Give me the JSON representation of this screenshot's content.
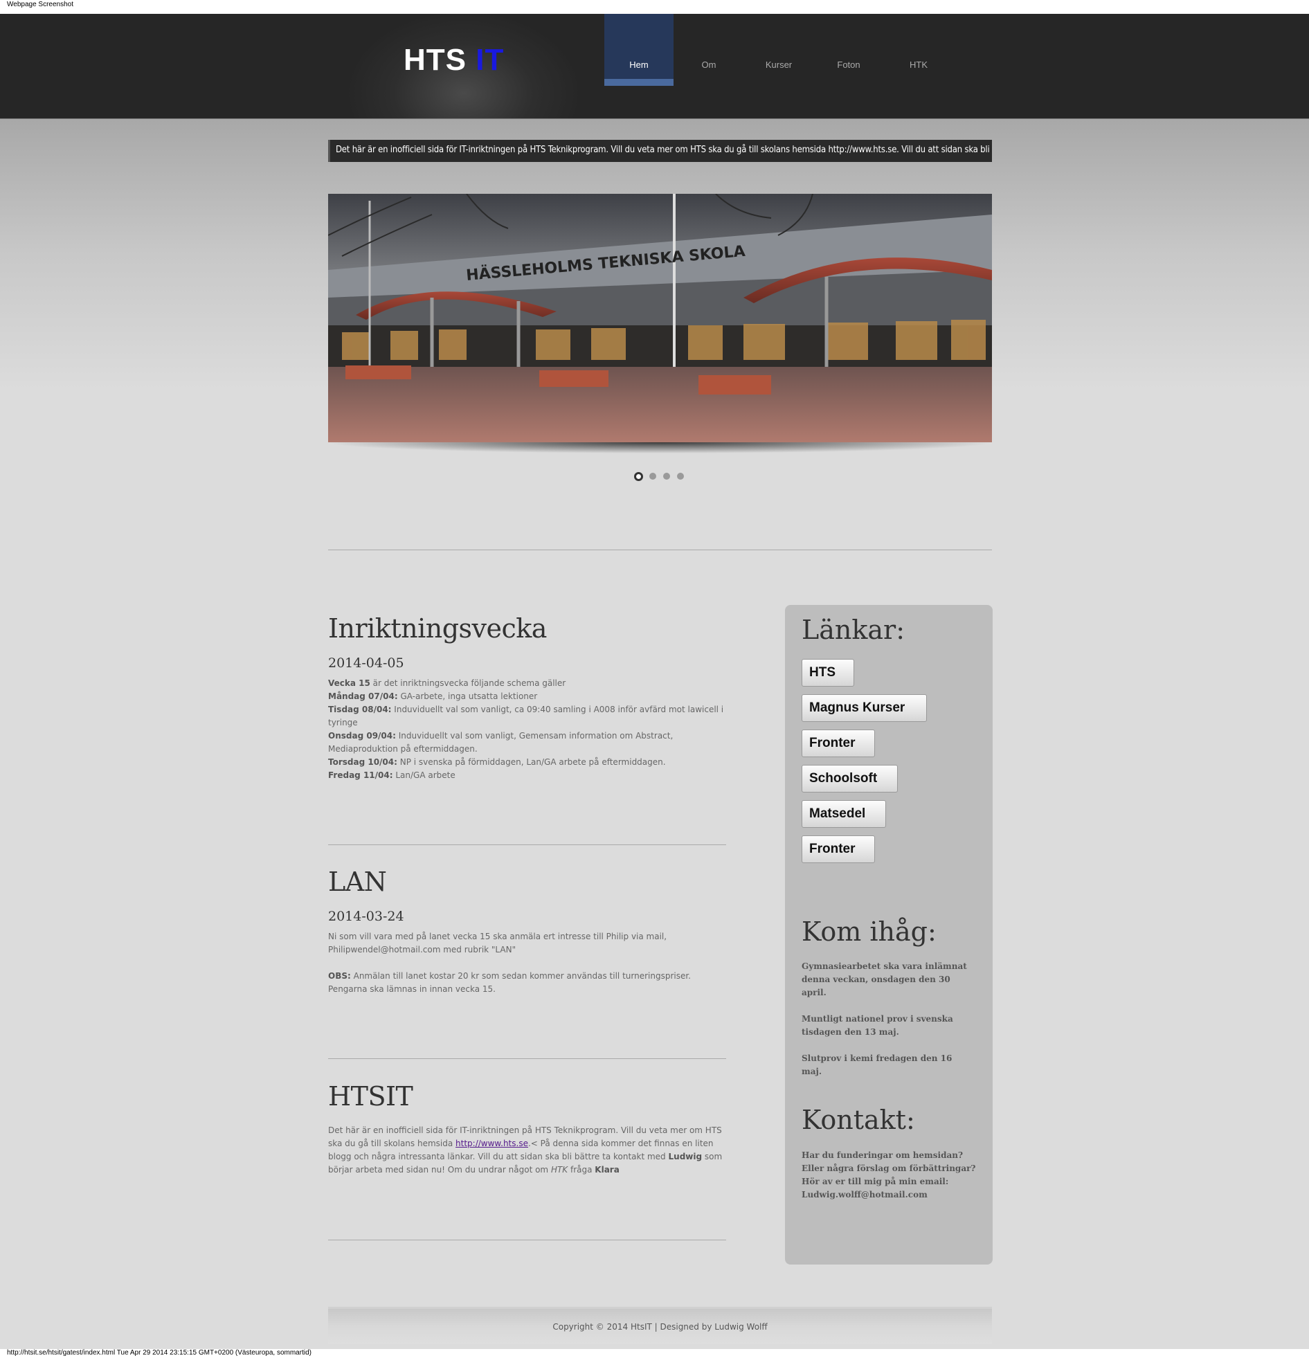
{
  "screenshot_label": "Webpage Screenshot",
  "status_url": "http://htsit.se/htsit/gatest/index.html Tue Apr 29 2014 23:15:15 GMT+0200 (Västeuropa, sommartid)",
  "logo": {
    "text_main": "HTS",
    "text_accent": "IT"
  },
  "nav": [
    {
      "label": "Hem",
      "active": true
    },
    {
      "label": "Om"
    },
    {
      "label": "Kurser"
    },
    {
      "label": "Foton"
    },
    {
      "label": "HTK"
    }
  ],
  "ticker": "Det här är en inofficiell sida för IT-inriktningen på HTS Teknikprogram. Vill du veta mer om HTS ska du gå till skolans hemsida http://www.hts.se. Vill du att sidan ska bli bättre",
  "slider": {
    "sign_text": "HÄSSLEHOLMS TEKNISKA SKOLA",
    "dot_count": 4,
    "active_dot": 0
  },
  "articles": [
    {
      "title": "Inriktningsvecka",
      "date": "2014-04-05",
      "lines": [
        {
          "bold": "Vecka 15",
          "text": " är det inriktningsvecka följande schema gäller"
        },
        {
          "bold": "Måndag 07/04:",
          "text": " GA-arbete, inga utsatta lektioner"
        },
        {
          "bold": "Tisdag 08/04:",
          "text": " Induviduellt val som vanligt, ca 09:40 samling i A008 inför avfärd mot lawicell i tyringe"
        },
        {
          "bold": "Onsdag 09/04:",
          "text": " Induviduellt val som vanligt, Gemensam information om Abstract, Mediaproduktion på eftermiddagen."
        },
        {
          "bold": "Torsdag 10/04:",
          "text": " NP i svenska på förmiddagen, Lan/GA arbete på eftermiddagen."
        },
        {
          "bold": "Fredag 11/04:",
          "text": " Lan/GA arbete"
        }
      ]
    },
    {
      "title": "LAN",
      "date": "2014-03-24",
      "para1": "Ni som vill vara med på lanet vecka 15 ska anmäla ert intresse till Philip via mail, Philipwendel@hotmail.com med rubrik \"LAN\"",
      "para2_bold": "OBS:",
      "para2": " Anmälan till lanet kostar 20 kr som sedan kommer användas till turneringspriser. Pengarna ska lämnas in innan vecka 15."
    },
    {
      "title": "HTSIT",
      "t1": "Det här är en inofficiell sida för IT-inriktningen på HTS Teknikprogram. Vill du veta mer om HTS ska du gå till skolans hemsida ",
      "link": "http://www.hts.se",
      "t2": ".< På denna sida kommer det finnas en liten blogg och några intressanta länkar. Vill du att sidan ska bli bättre ta kontakt med ",
      "b1": "Ludwig",
      "t3": " som börjar arbeta med sidan nu! Om du undrar något om ",
      "i1": "HTK",
      "t4": " fråga ",
      "b2": "Klara"
    }
  ],
  "sidebar": {
    "links_title": "Länkar:",
    "links": [
      "HTS",
      "Magnus Kurser",
      "Fronter",
      "Schoolsoft",
      "Matsedel",
      "Fronter"
    ],
    "remember_title": "Kom ihåg:",
    "remember": [
      "Gymnasiearbetet ska vara inlämnat denna veckan, onsdagen den 30 april.",
      "Muntligt nationel prov i svenska tisdagen den 13 maj.",
      "Slutprov i kemi fredagen den 16 maj."
    ],
    "contact_title": "Kontakt:",
    "contact_lines": [
      "Har du funderingar om hemsidan?",
      "Eller några förslag om förbättringar?",
      "Hör av er till mig på min email:",
      "Ludwig.wolff@hotmail.com"
    ]
  },
  "footer": "Copyright © 2014 HtsIT | Designed by Ludwig Wolff"
}
